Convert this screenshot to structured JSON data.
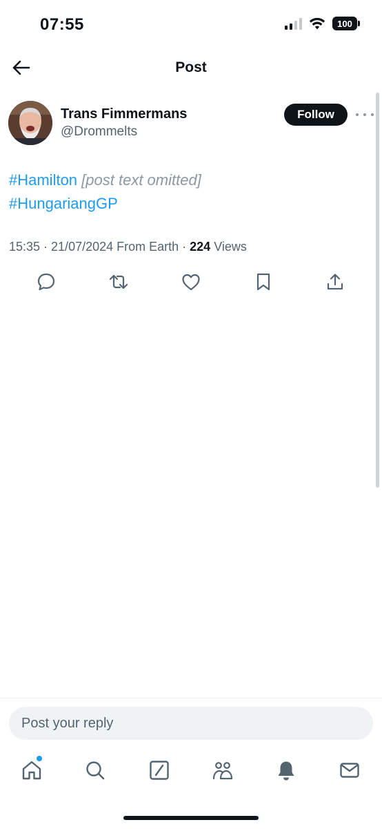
{
  "status_bar": {
    "time": "07:55",
    "battery": "100"
  },
  "header": {
    "title": "Post"
  },
  "post": {
    "author_name": "Trans Fimmermans",
    "author_handle": "@Drommelts",
    "follow_label": "Follow",
    "body_omitted_note": "[post text omitted]",
    "hashtags": [
      "#Hamilton",
      "#HungariangGP"
    ],
    "timestamp": "15:35 · 21/07/2024 From Earth · ",
    "views_count": "224",
    "views_label": " Views"
  },
  "actions": {
    "icons": [
      "reply-icon",
      "repost-icon",
      "like-icon",
      "bookmark-icon",
      "share-icon"
    ]
  },
  "reply": {
    "placeholder": "Post your reply"
  },
  "tab_bar": {
    "icons": [
      "home-icon",
      "search-icon",
      "grok-icon",
      "communities-icon",
      "notifications-icon",
      "messages-icon"
    ]
  },
  "colors": {
    "accent": "#1d9bf0",
    "text_primary": "#0f1419",
    "text_secondary": "#536471",
    "follow_bg": "#0f1419",
    "reply_bg": "#eff3f4"
  }
}
